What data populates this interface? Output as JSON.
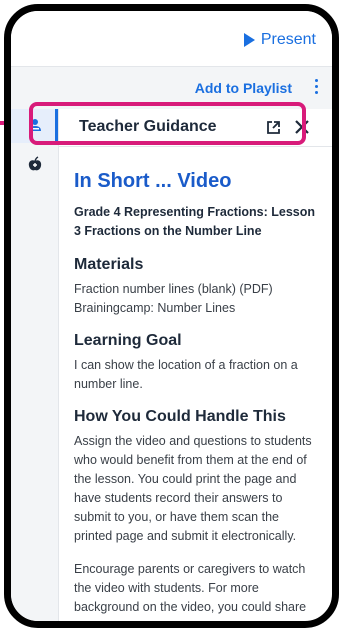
{
  "header": {
    "present_label": "Present"
  },
  "toolbar": {
    "add_to_playlist": "Add to Playlist"
  },
  "panel": {
    "title": "Teacher Guidance"
  },
  "content": {
    "title": "In Short ... Video",
    "subtitle": "Grade 4 Representing Fractions: Lesson 3 Fractions on the Number Line",
    "materials_heading": "Materials",
    "materials": [
      "Fraction number lines (blank) (PDF)",
      "Brainingcamp: Number Lines"
    ],
    "goal_heading": "Learning Goal",
    "goal_text": "I can show the location of a fraction on a number line.",
    "handle_heading": "How You Could Handle This",
    "handle_p1": "Assign the video and questions to students who would benefit from them at the end of the lesson. You could print the page and have students record their answers to submit to you, or have them scan the printed page and submit it electronically.",
    "handle_p2": "Encourage parents or caregivers to watch the video with students. For more background on the video, you could share"
  },
  "colors": {
    "accent": "#1a6fe0",
    "highlight": "#d81b7a"
  }
}
